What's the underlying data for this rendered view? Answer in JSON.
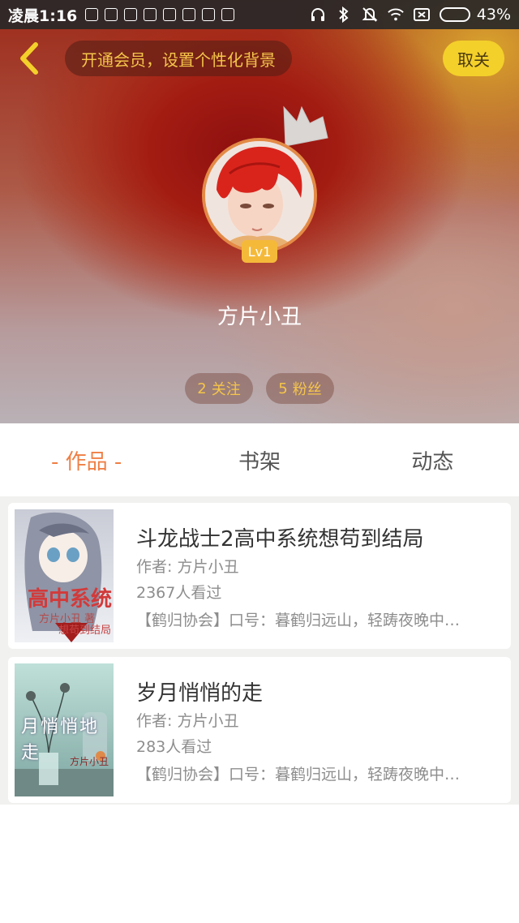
{
  "status_bar": {
    "time": "凌晨1:16",
    "battery_percent": "43%",
    "battery_level": 0.43
  },
  "header": {
    "vip_banner": "开通会员，设置个性化背景",
    "close_label": "取关"
  },
  "profile": {
    "level": "Lv1",
    "username": "方片小丑",
    "following_count": "2",
    "following_label": "关注",
    "fans_count": "5",
    "fans_label": "粉丝"
  },
  "tabs": [
    {
      "label": "- 作品 -",
      "active": true
    },
    {
      "label": "书架",
      "active": false
    },
    {
      "label": "动态",
      "active": false
    }
  ],
  "books": [
    {
      "title": "斗龙战士2高中系统想苟到结局",
      "author": "作者: 方片小丑",
      "views": "2367人看过",
      "description": "【鹤归协会】口号：暮鹤归远山，轻踌夜晚中…",
      "cover_text_main": "高中系统",
      "cover_text_sub": "想苟到结局",
      "cover_text_small": "方片小丑 著"
    },
    {
      "title": "岁月悄悄的走",
      "author": "作者: 方片小丑",
      "views": "283人看过",
      "description": "【鹤归协会】口号：暮鹤归远山，轻踌夜晚中…",
      "cover_text_main": "月悄悄地走",
      "cover_text_small": "方片小丑"
    }
  ],
  "colors": {
    "accent_orange": "#ef7f45",
    "vip_gold": "#f5c54a",
    "button_yellow": "#f4d02a",
    "hero_red": "#9d2a1a"
  }
}
